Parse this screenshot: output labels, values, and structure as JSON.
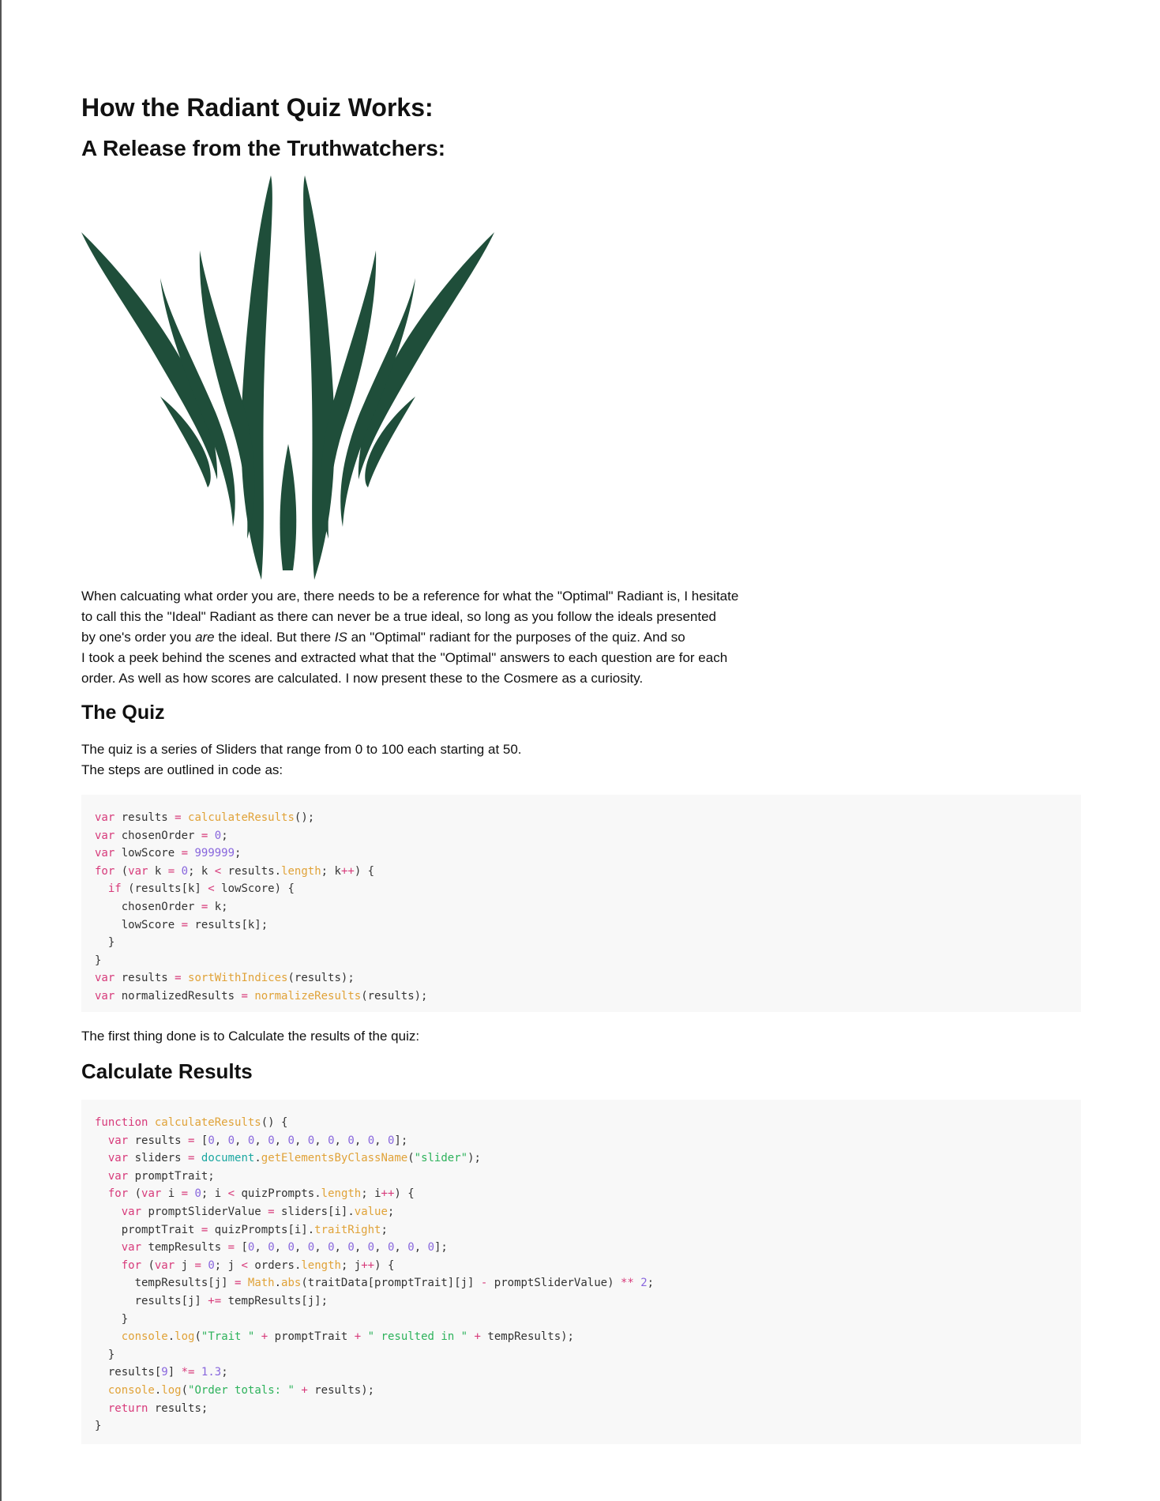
{
  "page": {
    "title": "How the Radiant Quiz Works:",
    "subtitle": "A Release from the Truthwatchers:",
    "logo_icon": "truthwatcher-glyph-icon",
    "logo_color": "#1f4e3a",
    "intro": [
      "When calcuating what order you are, there needs to be a reference for what the \"Optimal\" Radiant is, I hesitate",
      "to call this the \"Ideal\" Radiant as there can never be a true ideal, so long as you follow the ideals presented",
      "by one's order you ",
      "are",
      " the ideal. But there ",
      "IS",
      " an \"Optimal\" radiant for the purposes of the quiz. And so",
      "I took a peek behind the scenes and extracted what that the \"Optimal\" answers to each question are for each",
      "order. As well as how scores are calculated. I now present these to the Cosmere as a curiosity."
    ],
    "quiz_heading": "The Quiz",
    "quiz_desc": "The quiz is a series of Sliders that range from 0 to 100 each starting at 50.\nThe steps are outlined in code as:",
    "first_thing": "The first thing done is to Calculate the results of the quiz:",
    "calc_heading": "Calculate Results"
  },
  "code_blocks": {
    "main_code": [
      "var results = calculateResults();",
      "var chosenOrder = 0;",
      "var lowScore = 999999;",
      "for (var k = 0; k < results.length; k++) {",
      "  if (results[k] < lowScore) {",
      "    chosenOrder = k;",
      "    lowScore = results[k];",
      "  }",
      "}",
      "var results = sortWithIndices(results);",
      "var normalizedResults = normalizeResults(results);"
    ],
    "calc_code": [
      "function calculateResults() {",
      "  var results = [0, 0, 0, 0, 0, 0, 0, 0, 0, 0];",
      "  var sliders = document.getElementsByClassName(\"slider\");",
      "  var promptTrait;",
      "  for (var i = 0; i < quizPrompts.length; i++) {",
      "    var promptSliderValue = sliders[i].value;",
      "    promptTrait = quizPrompts[i].traitRight;",
      "    var tempResults = [0, 0, 0, 0, 0, 0, 0, 0, 0, 0];",
      "    for (var j = 0; j < orders.length; j++) {",
      "      tempResults[j] = Math.abs(traitData[promptTrait][j] - promptSliderValue) ** 2;",
      "      results[j] += tempResults[j];",
      "    }",
      "    console.log(\"Trait \" + promptTrait + \" resulted in \" + tempResults);",
      "  }",
      "  results[9] *= 1.3;",
      "  console.log(\"Order totals: \" + results);",
      "  return results;",
      "}"
    ]
  }
}
